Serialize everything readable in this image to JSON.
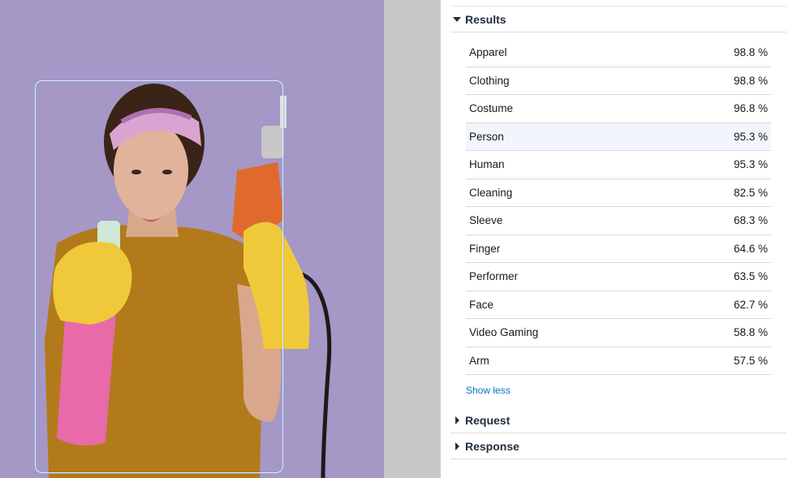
{
  "results_section": {
    "title": "Results",
    "rows": [
      {
        "label": "Apparel",
        "value": "98.8 %"
      },
      {
        "label": "Clothing",
        "value": "98.8 %"
      },
      {
        "label": "Costume",
        "value": "96.8 %"
      },
      {
        "label": "Person",
        "value": "95.3 %"
      },
      {
        "label": "Human",
        "value": "95.3 %"
      },
      {
        "label": "Cleaning",
        "value": "82.5 %"
      },
      {
        "label": "Sleeve",
        "value": "68.3 %"
      },
      {
        "label": "Finger",
        "value": "64.6 %"
      },
      {
        "label": "Performer",
        "value": "63.5 %"
      },
      {
        "label": "Face",
        "value": "62.7 %"
      },
      {
        "label": "Video Gaming",
        "value": "58.8 %"
      },
      {
        "label": "Arm",
        "value": "57.5 %"
      }
    ],
    "highlighted_index": 3,
    "show_less_label": "Show less"
  },
  "request_section": {
    "title": "Request"
  },
  "response_section": {
    "title": "Response"
  },
  "colors": {
    "image_background": "#a597c6",
    "link": "#0073bb",
    "highlight_row": "#f1f6fc",
    "bounding_box": "#d9f0ff"
  },
  "icons": {
    "expanded": "caret-down-icon",
    "collapsed": "caret-right-icon"
  }
}
